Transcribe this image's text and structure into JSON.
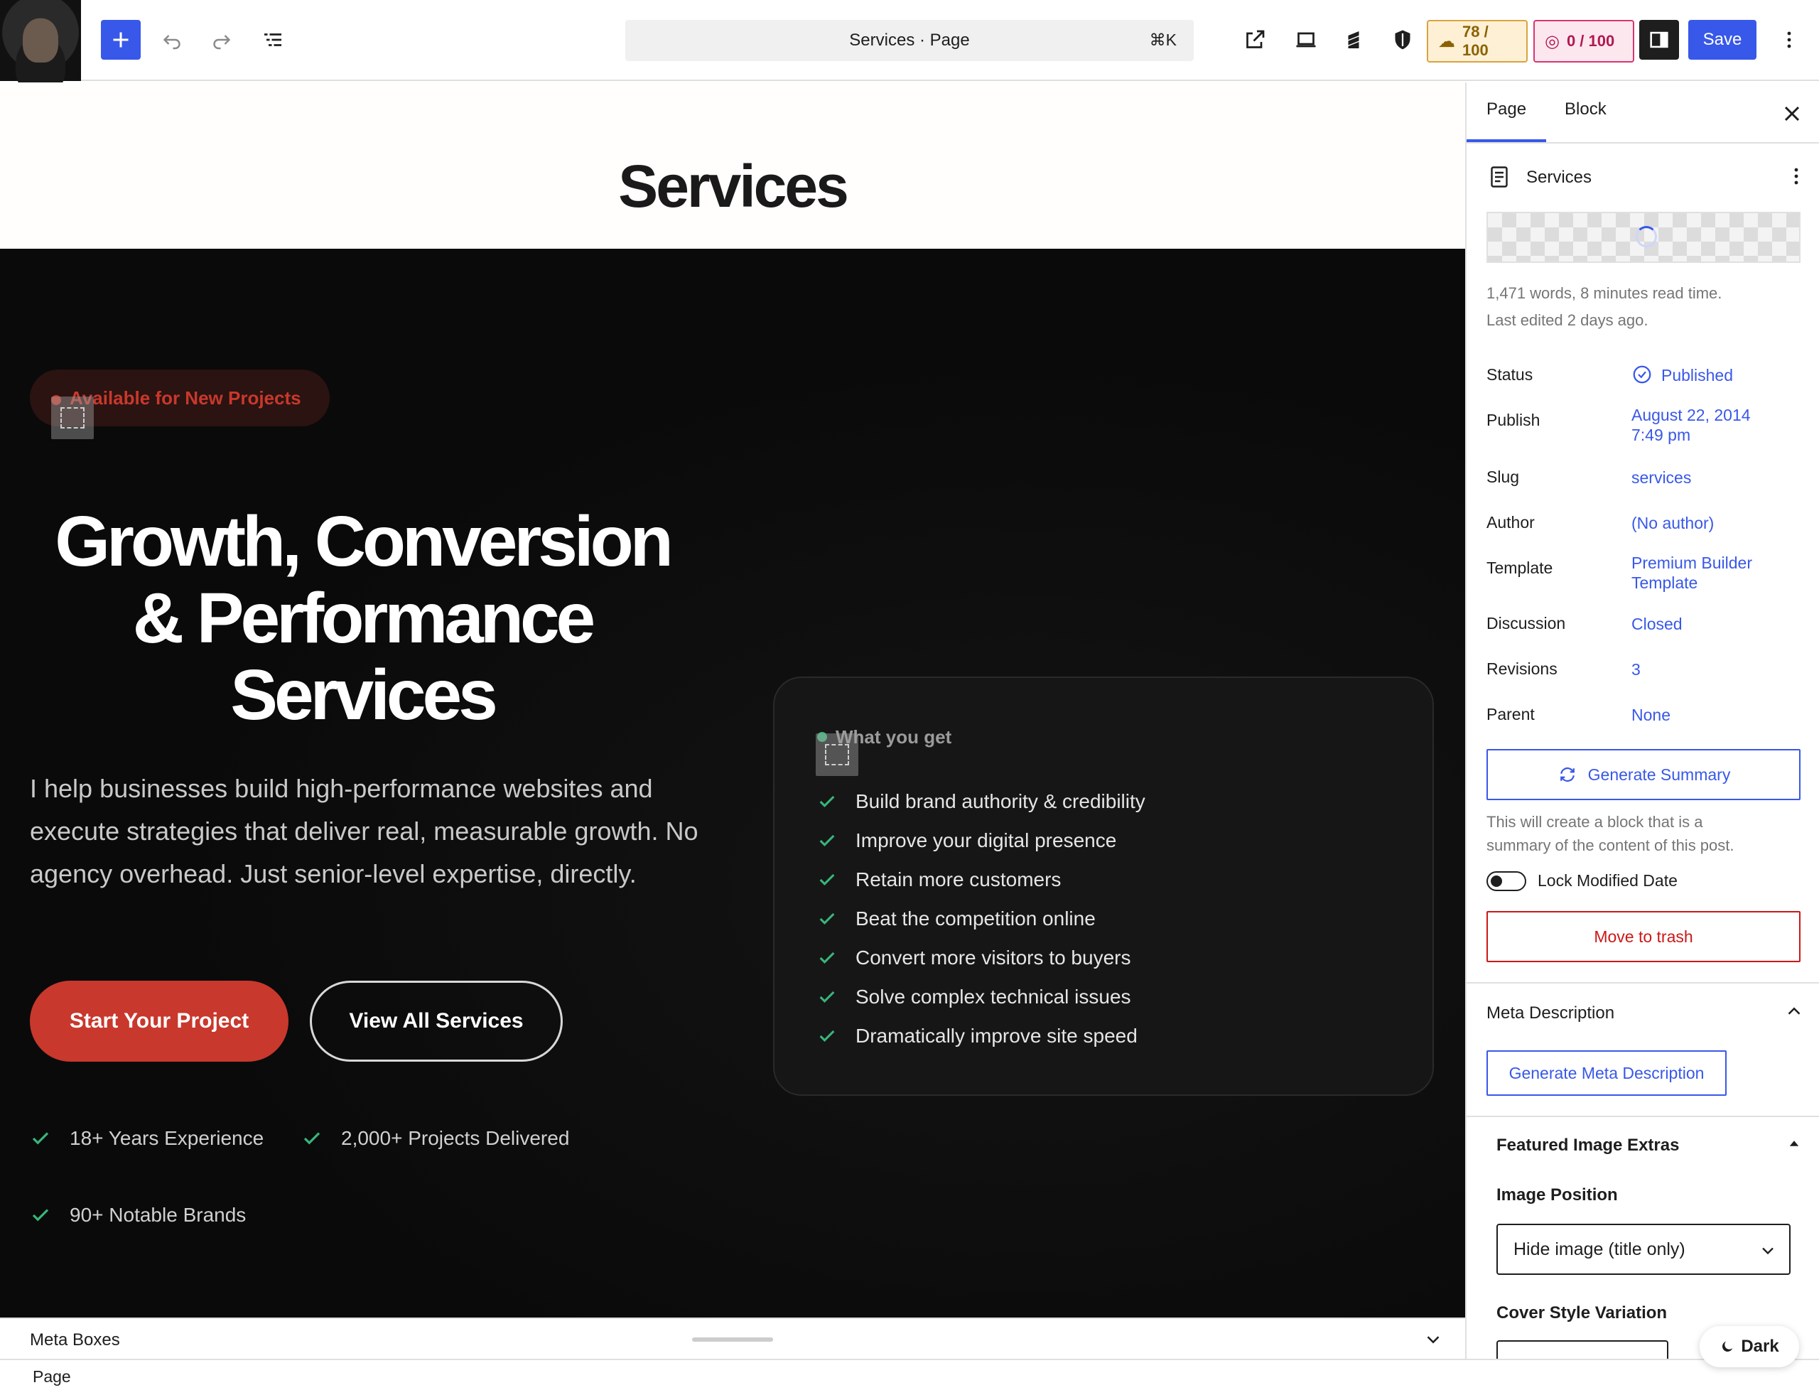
{
  "toolbar": {
    "command_title": "Services · Page",
    "command_shortcut": "⌘K",
    "score_seo": "78 / 100",
    "score_readability": "0 / 100",
    "save_label": "Save"
  },
  "canvas": {
    "page_title": "Services",
    "badge": "Available for New Projects",
    "headline_lines": [
      "Growth, Conversion",
      "& Performance",
      "Services"
    ],
    "intro": "I help businesses build high-performance websites and execute strategies that deliver real, measurable growth. No agency overhead. Just senior-level expertise, directly.",
    "primary_cta": "Start Your Project",
    "secondary_cta": "View All Services",
    "stats": [
      "18+ Years Experience",
      "2,000+ Projects Delivered",
      "90+ Notable Brands"
    ],
    "card": {
      "label": "What you get",
      "items": [
        "Build brand authority & credibility",
        "Improve your digital presence",
        "Retain more customers",
        "Beat the competition online",
        "Convert more visitors to buyers",
        "Solve complex technical issues",
        "Dramatically improve site speed"
      ]
    }
  },
  "bottom": {
    "meta_boxes_label": "Meta Boxes",
    "breadcrumb": "Page"
  },
  "sidebar": {
    "tabs": [
      "Page",
      "Block"
    ],
    "doc_title": "Services",
    "stats_line1": "1,471 words, 8 minutes read time.",
    "stats_line2": "Last edited 2 days ago.",
    "rows": {
      "status": {
        "label": "Status",
        "value": "Published"
      },
      "publish": {
        "label": "Publish",
        "value_line1": "August 22, 2014",
        "value_line2": "7:49 pm"
      },
      "slug": {
        "label": "Slug",
        "value": "services"
      },
      "author": {
        "label": "Author",
        "value": "(No author)"
      },
      "template": {
        "label": "Template",
        "value_line1": "Premium Builder",
        "value_line2": "Template"
      },
      "discussion": {
        "label": "Discussion",
        "value": "Closed"
      },
      "revisions": {
        "label": "Revisions",
        "value": "3"
      },
      "parent": {
        "label": "Parent",
        "value": "None"
      }
    },
    "generate_summary": "Generate Summary",
    "summary_help_line1": "This will create a block that is a",
    "summary_help_line2": "summary of the content of this post.",
    "lock_modified_label": "Lock Modified Date",
    "trash_label": "Move to trash",
    "meta_description_title": "Meta Description",
    "generate_meta_label": "Generate Meta Description",
    "featured_extras_title": "Featured Image Extras",
    "image_position_label": "Image Position",
    "image_position_value": "Hide image (title only)",
    "cover_style_label": "Cover Style Variation",
    "dark_toggle_label": "Dark"
  },
  "colors": {
    "accent": "#3858e9",
    "brand_red": "#c8382c",
    "check_green": "#38b57a",
    "danger": "#cc1818"
  }
}
